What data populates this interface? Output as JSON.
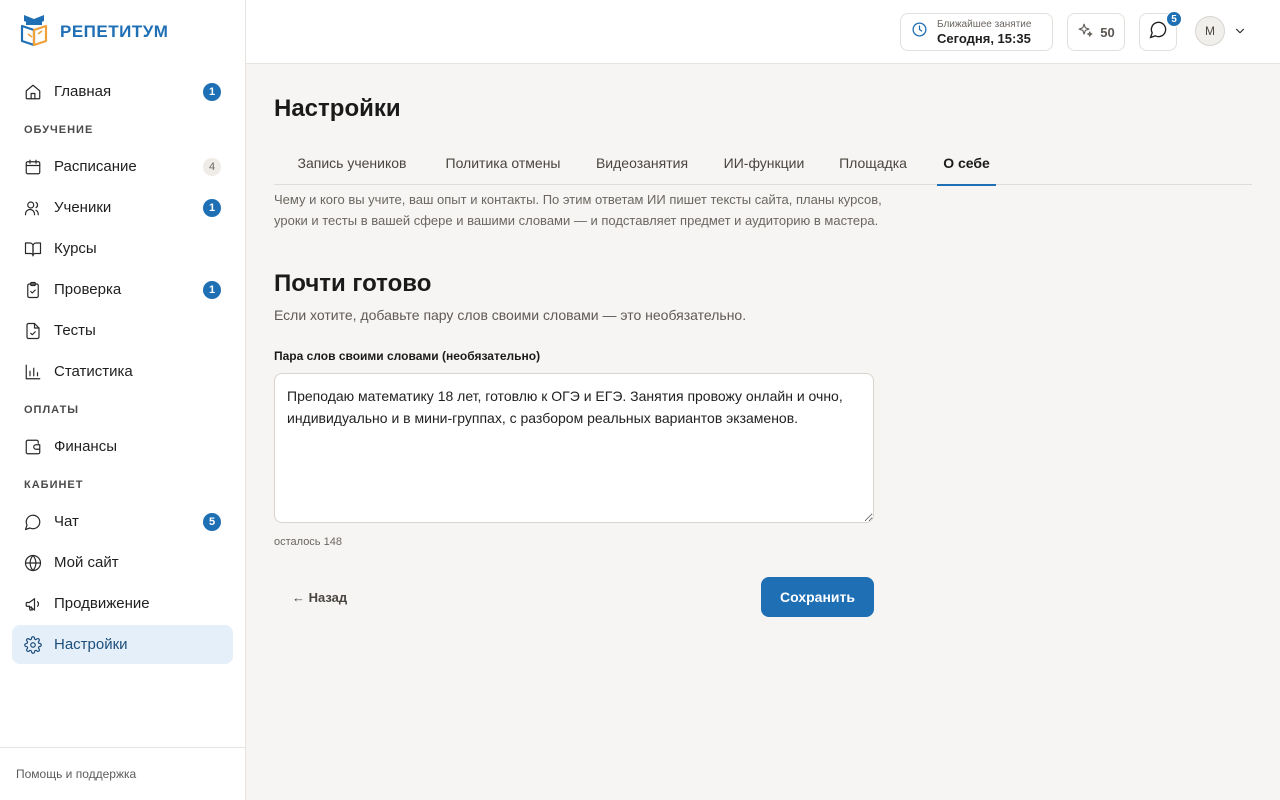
{
  "app": {
    "logo_text": "РЕПЕТИТУМ",
    "accent": "#1f6fb5"
  },
  "sidebar": {
    "home": {
      "label": "Главная",
      "badge": "1",
      "icon": "home-icon"
    },
    "sections": [
      {
        "title": "ОБУЧЕНИЕ",
        "items": [
          {
            "label": "Расписание",
            "badge": "4",
            "badge_style": "muted",
            "icon": "calendar-icon"
          },
          {
            "label": "Ученики",
            "badge": "1",
            "icon": "users-icon"
          },
          {
            "label": "Курсы",
            "badge": "",
            "icon": "book-icon"
          },
          {
            "label": "Проверка",
            "badge": "1",
            "icon": "clipboard-check-icon"
          },
          {
            "label": "Тесты",
            "badge": "",
            "icon": "file-check-icon"
          },
          {
            "label": "Статистика",
            "badge": "",
            "icon": "bar-chart-icon"
          }
        ]
      },
      {
        "title": "ОПЛАТЫ",
        "items": [
          {
            "label": "Финансы",
            "badge": "",
            "icon": "wallet-icon"
          }
        ]
      },
      {
        "title": "КАБИНЕТ",
        "items": [
          {
            "label": "Чат",
            "badge": "5",
            "icon": "chat-icon"
          },
          {
            "label": "Мой сайт",
            "badge": "",
            "icon": "globe-icon"
          },
          {
            "label": "Продвижение",
            "badge": "",
            "icon": "megaphone-icon"
          },
          {
            "label": "Настройки",
            "badge": "",
            "icon": "gear-icon",
            "active": true
          }
        ]
      }
    ],
    "footer": "Помощь и поддержка"
  },
  "header": {
    "next_lesson_label": "Ближайшее занятие",
    "next_lesson_value": "Сегодня, 15:35",
    "ai_credits": "50",
    "chat_badge": "5",
    "avatar_initial": "М"
  },
  "main": {
    "title": "Настройки",
    "tabs": [
      {
        "label": "Запись учеников"
      },
      {
        "label": "Политика отмены"
      },
      {
        "label": "Видеозанятия"
      },
      {
        "label": "ИИ-функции"
      },
      {
        "label": "Площадка"
      },
      {
        "label": "О себе",
        "active": true
      }
    ],
    "intro": "Чему и кого вы учите, ваш опыт и контакты. По этим ответам ИИ пишет тексты сайта, планы курсов, уроки и тесты в вашей сфере и вашими словами — и подставляет предмет и аудиторию в мастера.",
    "heading": "Почти готово",
    "subheading": "Если хотите, добавьте пару слов своими словами — это необязательно.",
    "field_label": "Пара слов своими словами (необязательно)",
    "field_value": "Преподаю математику 18 лет, готовлю к ОГЭ и ЕГЭ. Занятия провожу онлайн и очно, индивидуально и в мини-группах, с разбором реальных вариантов экзаменов.",
    "counter": "осталось 148",
    "back_label": "← Назад",
    "save_label": "Сохранить"
  }
}
